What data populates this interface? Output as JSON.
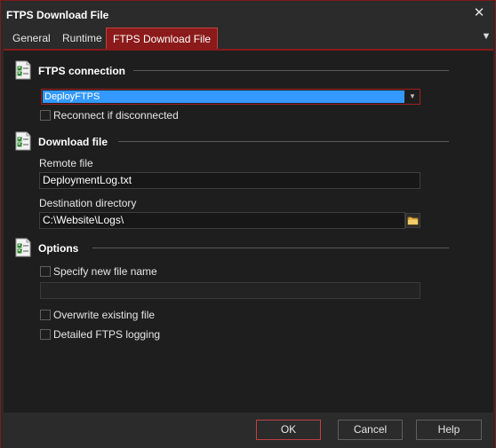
{
  "window": {
    "title": "FTPS Download File",
    "close_glyph": "✕"
  },
  "tabs": [
    {
      "label": "General"
    },
    {
      "label": "Runtime"
    },
    {
      "label": "FTPS Download File",
      "active": true
    }
  ],
  "tab_menu_glyph": "▼",
  "sections": {
    "connection": {
      "title": "FTPS connection",
      "selected": "DeployFTPS",
      "arrow_glyph": "▼",
      "reconnect_label": "Reconnect if disconnected",
      "reconnect_checked": false
    },
    "download": {
      "title": "Download file",
      "remote_label": "Remote file",
      "remote_value": "DeploymentLog.txt",
      "dest_label": "Destination directory",
      "dest_value": "C:\\Website\\Logs\\"
    },
    "options": {
      "title": "Options",
      "specify_label": "Specify new file name",
      "specify_checked": false,
      "new_name_value": "",
      "overwrite_label": "Overwrite existing file",
      "overwrite_checked": false,
      "logging_label": "Detailed FTPS logging",
      "logging_checked": false
    }
  },
  "footer": {
    "ok": "OK",
    "cancel": "Cancel",
    "help": "Help"
  },
  "colors": {
    "accent": "#8b1a1a",
    "selection": "#3399ff",
    "background": "#1e1e1e",
    "chrome": "#2b2b2b"
  },
  "icons": {
    "section": "checklist-icon",
    "browse": "folder-icon",
    "close": "close-icon",
    "menu": "menu-arrow-icon"
  }
}
